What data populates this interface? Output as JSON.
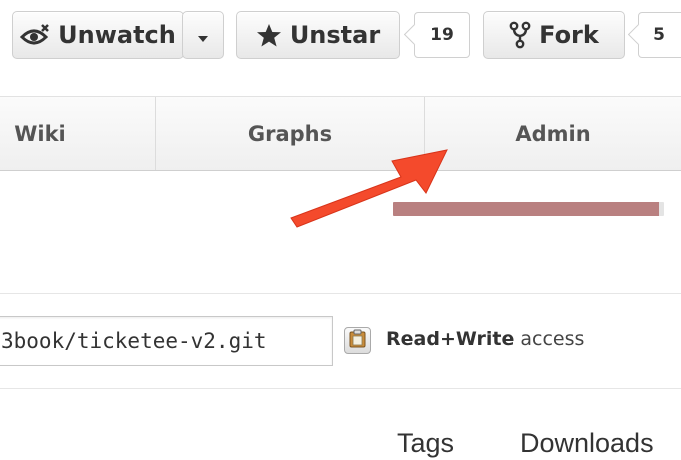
{
  "actions": {
    "unwatch_label": "Unwatch",
    "unstar_label": "Unstar",
    "star_count": "19",
    "fork_label": "Fork",
    "fork_count": "5"
  },
  "tabs": [
    {
      "label": "Wiki"
    },
    {
      "label": "Graphs"
    },
    {
      "label": "Admin"
    }
  ],
  "progress": {
    "fill_fraction": 0.98,
    "fill_color": "#b98080"
  },
  "clone": {
    "url_value": "3book/ticketee-v2.git",
    "access_strong": "Read+Write",
    "access_rest": " access"
  },
  "links": {
    "tags": "Tags",
    "downloads": "Downloads"
  },
  "colors": {
    "arrow": "#f44a2c"
  }
}
